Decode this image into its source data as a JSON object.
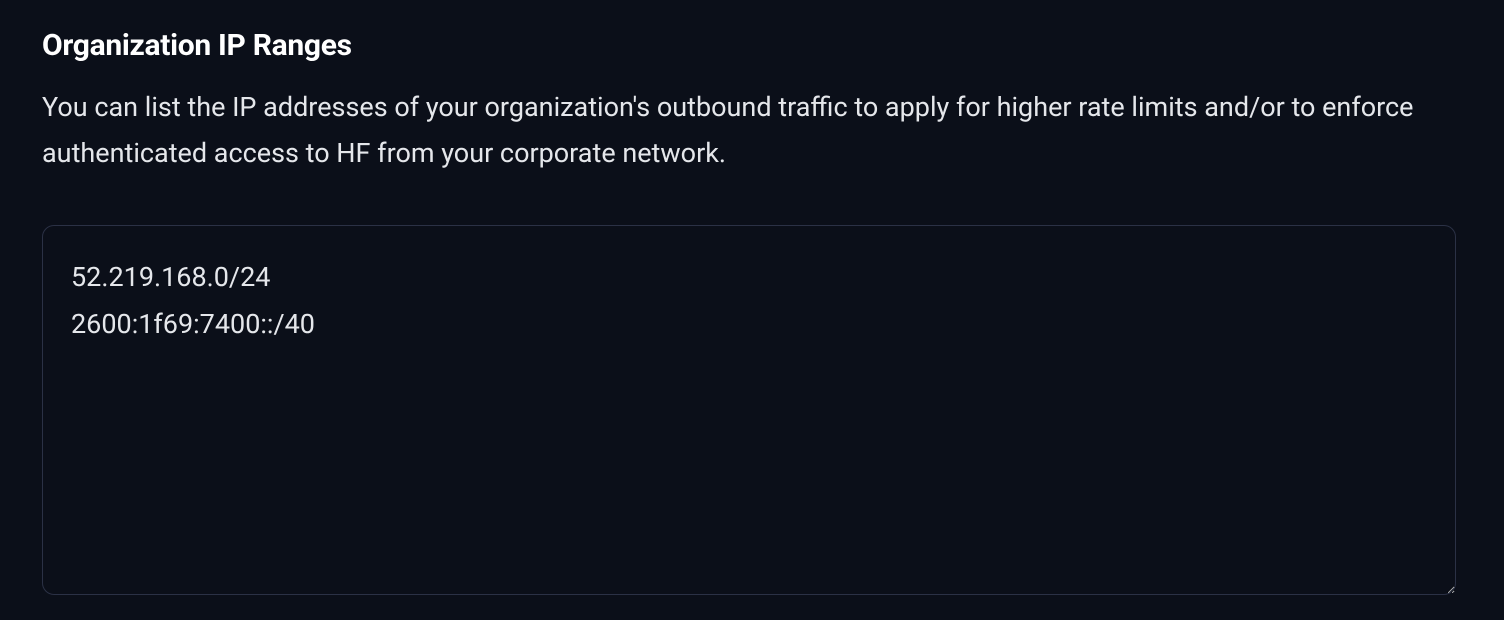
{
  "section": {
    "title": "Organization IP Ranges",
    "description": "You can list the IP addresses of your organization's outbound traffic to apply for higher rate limits and/or to enforce authenticated access to HF from your corporate network.",
    "textarea_value": "52.219.168.0/24\n2600:1f69:7400::/40"
  }
}
